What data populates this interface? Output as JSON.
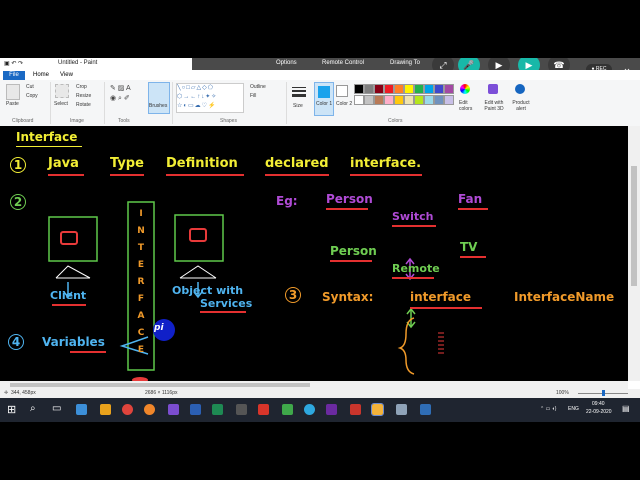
{
  "window": {
    "title": "Untitled - Paint"
  },
  "meeting_bar": {
    "options": "Options",
    "remote_control": "Remote Control",
    "drawing_tools": "Drawing To",
    "rec": "REC"
  },
  "tabs": {
    "file": "File",
    "home": "Home",
    "view": "View"
  },
  "ribbon": {
    "paste": "Paste",
    "cut": "Cut",
    "copy": "Copy",
    "select": "Select",
    "crop": "Crop",
    "resize": "Resize",
    "rotate": "Rotate",
    "brushes": "Brushes",
    "outline": "Outline",
    "fill": "Fill",
    "size": "Size",
    "color1": "Color 1",
    "color2": "Color 2",
    "edit_colors": "Edit colors",
    "edit_paint3d": "Edit with Paint 3D",
    "product_alert": "Product alert",
    "groups": {
      "clipboard": "Clipboard",
      "image": "Image",
      "tools": "Tools",
      "shapes": "Shapes",
      "colors": "Colors"
    },
    "palette": [
      "#000000",
      "#7f7f7f",
      "#880015",
      "#ed1c24",
      "#ff7f27",
      "#fff200",
      "#22b14c",
      "#00a2e8",
      "#3f48cc",
      "#a349a4",
      "#ffffff",
      "#c3c3c3",
      "#b97a57",
      "#ffaec9",
      "#ffc90e",
      "#efe4b0",
      "#b5e61d",
      "#99d9ea",
      "#7092be",
      "#c8bfe7"
    ]
  },
  "canvas": {
    "heading": "Interface",
    "n1": "1",
    "java": "Java",
    "type": "Type",
    "definition": "Definition",
    "declared": "declared",
    "interface_kw": "interface.",
    "n2": "2",
    "interface_vertical": [
      "I",
      "N",
      "T",
      "E",
      "R",
      "F",
      "A",
      "C",
      "E"
    ],
    "client": "Client",
    "object_with": "Object with",
    "services": "Services",
    "eg": "Eg:",
    "person1": "Person",
    "switch": "Switch",
    "fan": "Fan",
    "person2": "Person",
    "remote": "Remote",
    "tv": "TV",
    "n3": "3",
    "syntax": "Syntax:",
    "interface_syn": "interface",
    "interface_name": "InterfaceName",
    "n4": "4",
    "variables": "Variables",
    "pi": "pi"
  },
  "status": {
    "coords": "344, 458px",
    "size": "2686 × 1116px",
    "zoom": "100%"
  },
  "taskbar": {
    "time": "09:40",
    "date": "22-09-2020",
    "lang": "ENG"
  }
}
